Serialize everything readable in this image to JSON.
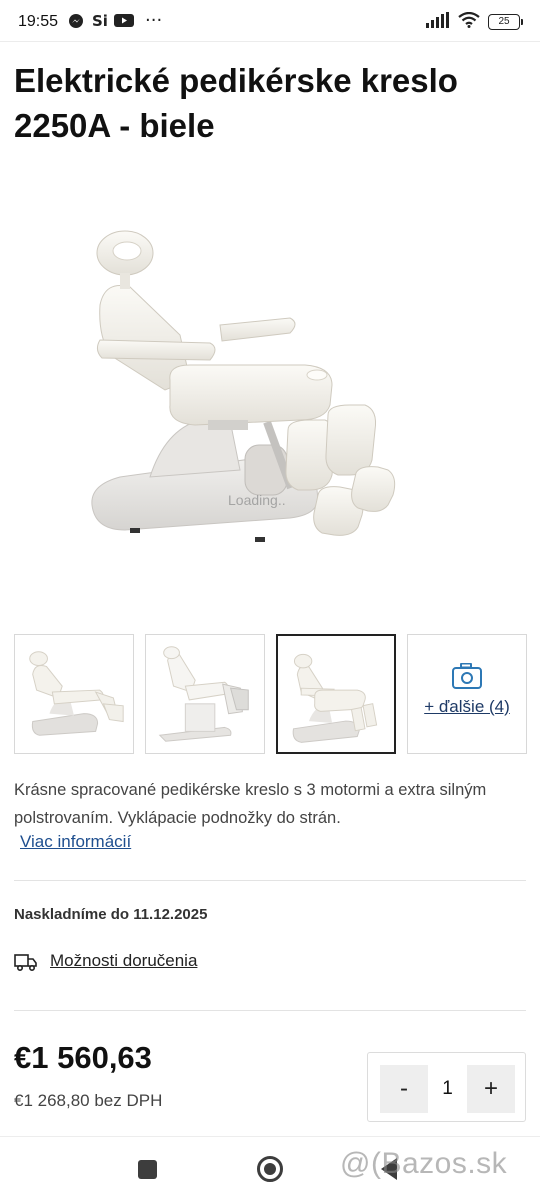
{
  "status_bar": {
    "time": "19:55",
    "battery": "25",
    "icons": [
      "messenger-icon",
      "si-icon",
      "youtube-icon",
      "more-dots-icon",
      "signal-icon",
      "wifi-icon",
      "battery-icon"
    ],
    "si_text": "Si",
    "dots": "···"
  },
  "product": {
    "title": "Elektrické pedikérske kreslo 2250A - biele",
    "loading_overlay": "Loading..",
    "thumbnails_more_label": "+ ďalšie (4)",
    "description": "Krásne spracované pedikérske kreslo s 3 motormi a extra silným polstrovaním. Vyklápacie podnožky do strán.",
    "more_info_link": "Viac informácií",
    "stock_note": "Naskladníme do 11.12.2025",
    "delivery_link": "Možnosti doručenia",
    "price": "€1 560,63",
    "price_without_vat": "€1 268,80 bez DPH",
    "quantity": {
      "minus": "-",
      "value": "1",
      "plus": "+"
    }
  },
  "watermark": "@(Bazos.sk",
  "colors": {
    "link": "#1f4f8f",
    "camera_icon": "#2d78b5",
    "chair": "#f1efe9"
  }
}
